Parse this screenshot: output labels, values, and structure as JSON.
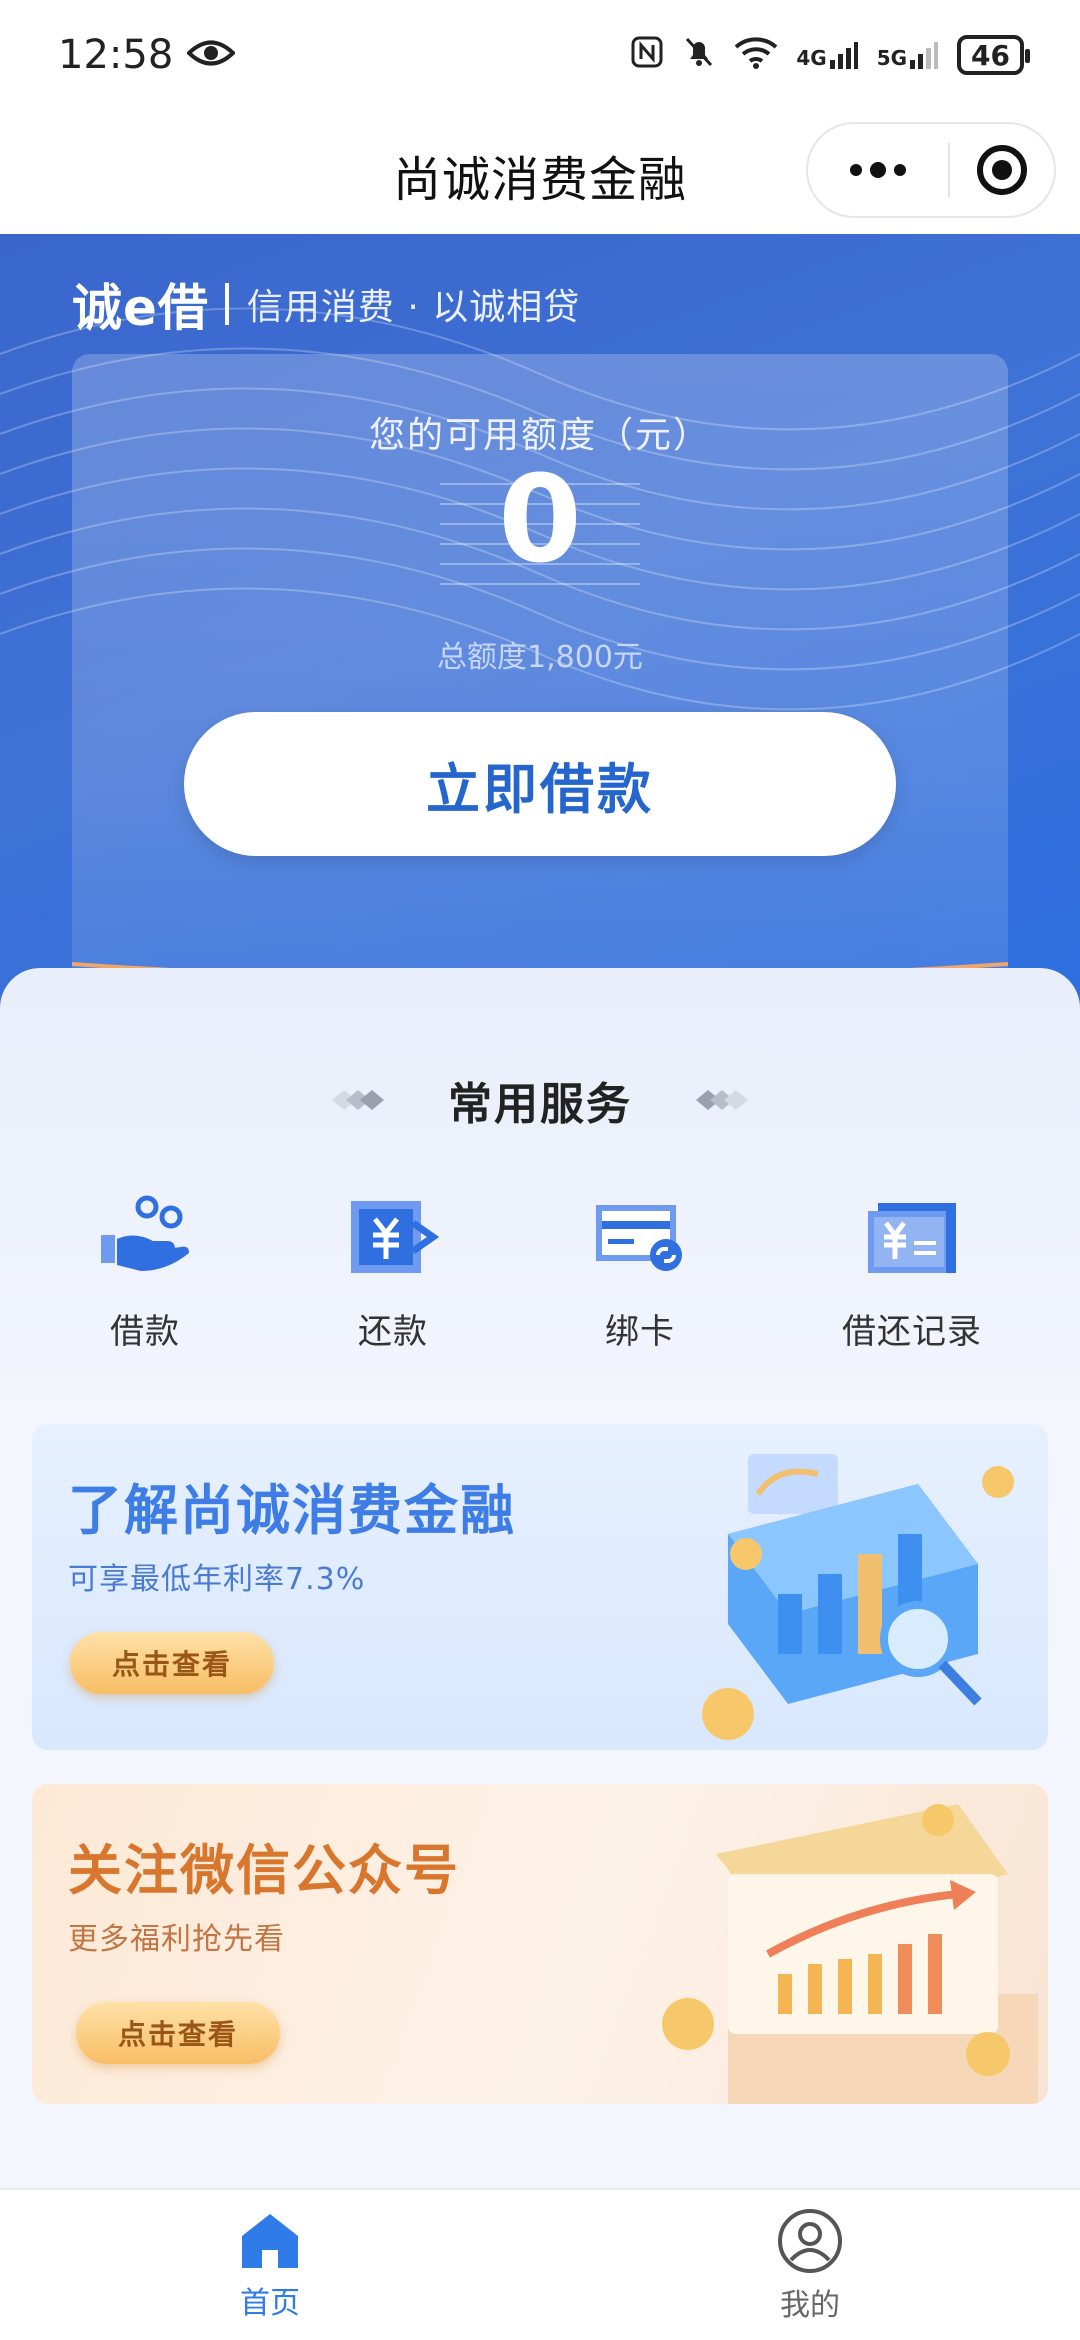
{
  "status_bar": {
    "time": "12:58",
    "battery": "46",
    "network_4g": "4G",
    "network_5g": "5G"
  },
  "header": {
    "title": "尚诚消费金融"
  },
  "hero": {
    "brand": "诚e借",
    "slogan": "信用消费 · 以诚相贷",
    "available_label": "您的可用额度（元）",
    "available_amount": "0",
    "total_limit": "总额度1,800元",
    "borrow_button": "立即借款"
  },
  "services": {
    "title": "常用服务",
    "items": [
      {
        "label": "借款",
        "icon": "borrow-hand-icon"
      },
      {
        "label": "还款",
        "icon": "repay-yuan-icon"
      },
      {
        "label": "绑卡",
        "icon": "bind-card-icon"
      },
      {
        "label": "借还记录",
        "icon": "records-icon"
      }
    ]
  },
  "banners": [
    {
      "title": "了解尚诚消费金融",
      "subtitle": "可享最低年利率7.3%",
      "button": "点击查看",
      "accent": "#3f7de6"
    },
    {
      "title": "关注微信公众号",
      "subtitle": "更多福利抢先看",
      "button": "点击查看",
      "accent": "#d9762d"
    }
  ],
  "tabbar": {
    "items": [
      {
        "label": "首页",
        "icon": "home-icon",
        "active": true
      },
      {
        "label": "我的",
        "icon": "profile-icon",
        "active": false
      }
    ],
    "active_color": "#2f7ce8"
  }
}
